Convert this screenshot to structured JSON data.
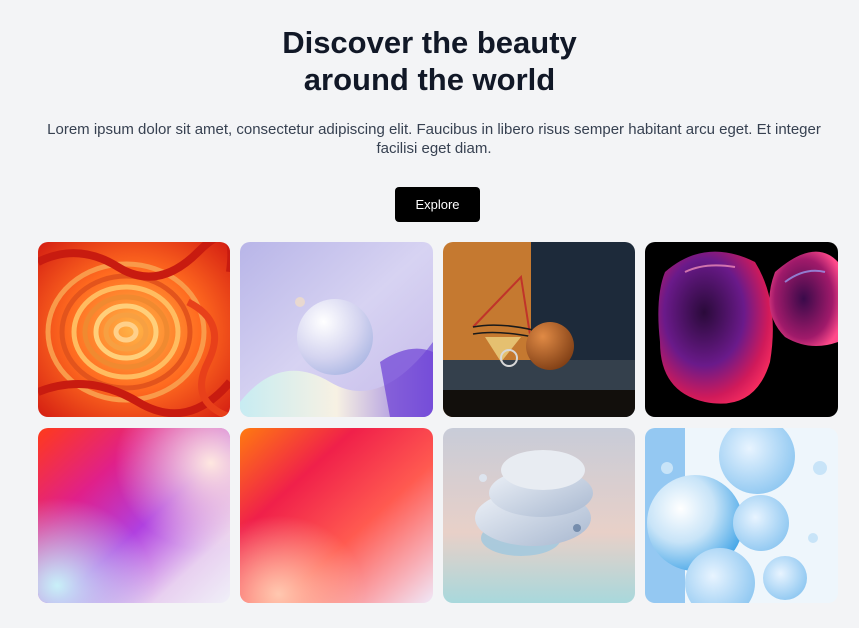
{
  "hero": {
    "title_line1": "Discover the beauty",
    "title_line2": "around the world",
    "description": "Lorem ipsum dolor sit amet, consectetur adipiscing elit. Faucibus in libero risus semper habitant arcu eget. Et integer facilisi eget diam.",
    "cta_label": "Explore"
  },
  "gallery": {
    "images": [
      {
        "subject": "orange-red swirl paper art"
      },
      {
        "subject": "pastel sphere on wave"
      },
      {
        "subject": "orange room with sphere"
      },
      {
        "subject": "iridescent blobs on black"
      },
      {
        "subject": "pink purple gradient blur"
      },
      {
        "subject": "red orange gradient blur"
      },
      {
        "subject": "stacked pastel discs"
      },
      {
        "subject": "blue oil bubbles"
      }
    ]
  },
  "colors": {
    "background": "#f3f4f6",
    "button": "#000000",
    "button_text": "#ffffff",
    "heading": "#111827",
    "body_text": "#374151"
  }
}
